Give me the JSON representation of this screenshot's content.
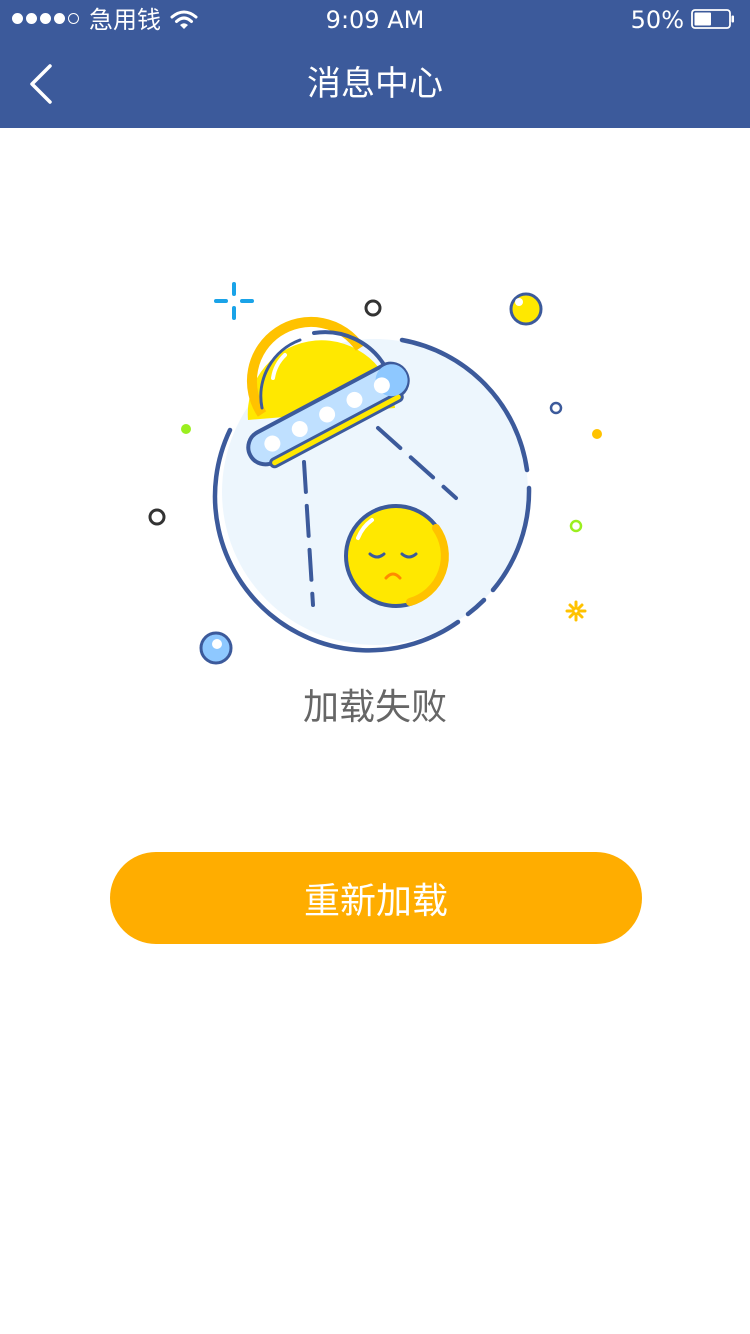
{
  "status_bar": {
    "carrier": "急用钱",
    "time": "9:09 AM",
    "battery_percent": "50%",
    "battery_level": 0.5,
    "signal_strength": 4,
    "signal_max": 5
  },
  "nav": {
    "back_icon": "chevron-left-icon",
    "title": "消息中心"
  },
  "content": {
    "illustration": "ufo-illustration",
    "message": "加载失败",
    "reload_label": "重新加载"
  },
  "colors": {
    "header": "#3c5a9b",
    "button": "#ffad00",
    "illustration_yellow": "#ffe800",
    "illustration_blue": "#3c5a9b"
  }
}
